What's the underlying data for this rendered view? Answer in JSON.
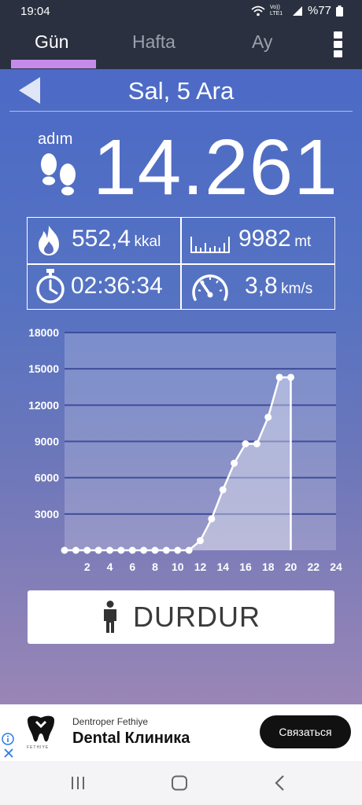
{
  "status_bar": {
    "time": "19:04",
    "network": "Vo)) LTE1",
    "battery": "%77"
  },
  "tabs": [
    {
      "label": "Gün",
      "active": true
    },
    {
      "label": "Hafta",
      "active": false
    },
    {
      "label": "Ay",
      "active": false
    }
  ],
  "date": {
    "label": "Sal, 5 Ara"
  },
  "steps": {
    "caption": "adım",
    "value": "14.261"
  },
  "stats": {
    "calories": {
      "value": "552,4",
      "unit": "kkal",
      "icon": "flame-icon"
    },
    "distance": {
      "value": "9982",
      "unit": "mt",
      "icon": "ruler-icon"
    },
    "duration": {
      "value": "02:36:34",
      "icon": "stopwatch-icon"
    },
    "speed": {
      "value": "3,8",
      "unit": "km/s",
      "icon": "speedometer-icon"
    }
  },
  "chart_data": {
    "type": "area",
    "title": "",
    "xlabel": "",
    "ylabel": "",
    "x": [
      0,
      1,
      2,
      3,
      4,
      5,
      6,
      7,
      8,
      9,
      10,
      11,
      12,
      13,
      14,
      15,
      16,
      17,
      18,
      19,
      20
    ],
    "values": [
      0,
      0,
      0,
      0,
      0,
      0,
      0,
      0,
      0,
      0,
      0,
      0,
      800,
      2600,
      5000,
      7200,
      8800,
      8800,
      11000,
      14300,
      14300
    ],
    "x_ticks": [
      2,
      4,
      6,
      8,
      10,
      12,
      14,
      16,
      18,
      20,
      22,
      24
    ],
    "y_ticks": [
      3000,
      6000,
      9000,
      12000,
      15000,
      18000
    ],
    "xlim": [
      0,
      24
    ],
    "ylim": [
      0,
      18000
    ],
    "grid": true,
    "colors": {
      "line": "#ffffff",
      "fill": "rgba(255,255,255,0.35)",
      "grid": "#3f4d9a",
      "labels": "#ffffff"
    }
  },
  "stop_button": {
    "label": "DURDUR",
    "icon": "person-icon"
  },
  "ad": {
    "advertiser": "Dentroper Fethiye",
    "headline": "Dental Клиника",
    "cta": "Связаться",
    "logo_caption": "FETHIYE"
  },
  "colors": {
    "header": "#2b3040",
    "accent": "#c68bea",
    "background_top": "#4c6ac6",
    "background_bottom": "#9a86b6"
  }
}
